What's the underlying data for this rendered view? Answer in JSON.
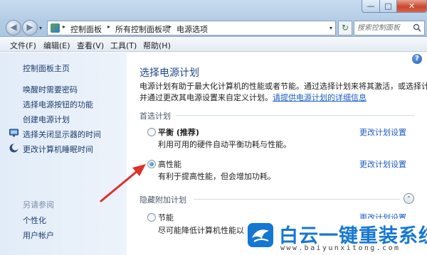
{
  "window": {
    "minimize_label": "—",
    "maximize_label": "□",
    "close_label": "✕"
  },
  "nav": {
    "back_label": "◀",
    "forward_label": "▶",
    "dropdown_label": "▾"
  },
  "address": {
    "crumbs": [
      "控制面板",
      "所有控制面板项",
      "电源选项"
    ],
    "separator": "▸",
    "dropdown_label": "▾",
    "refresh_label": "↻"
  },
  "search": {
    "placeholder": "搜索控制面板"
  },
  "menu": [
    "文件(F)",
    "编辑(E)",
    "查看(V)",
    "工具(T)",
    "帮助(H)"
  ],
  "sidebar": {
    "home": "控制面板主页",
    "items": [
      {
        "label": "唤醒时需要密码",
        "icon": ""
      },
      {
        "label": "选择电源按钮的功能",
        "icon": ""
      },
      {
        "label": "创建电源计划",
        "icon": ""
      },
      {
        "label": "选择关闭显示器的时间",
        "icon": "monitor-icon"
      },
      {
        "label": "更改计算机睡眠时间",
        "icon": "moon-icon"
      }
    ],
    "see_also_heading": "另请参阅",
    "see_also": [
      "个性化",
      "用户帐户"
    ]
  },
  "main": {
    "help_label": "?",
    "title": "选择电源计划",
    "description_line1": "电源计划有助于最大化计算机的性能或者节能。通过选择计划来将其激活，或选择计划",
    "description_line2": "并通过更改其电源设置来自定义计划。",
    "description_link": "请提供电源计划的详细信息",
    "preferred_heading": "首选计划",
    "hidden_heading": "隐藏附加计划",
    "collapse_label": "⌃",
    "plans": [
      {
        "name": "平衡 (推荐)",
        "desc": "利用可用的硬件自动平衡功耗与性能。",
        "link": "更改计划设置",
        "selected": false
      },
      {
        "name": "高性能",
        "desc": "有利于提高性能，但会增加功耗。",
        "link": "更改计划设置",
        "selected": true
      },
      {
        "name": "节能",
        "desc": "尽可能降低计算机性能以节能。",
        "link": "更改计划设置",
        "selected": false
      }
    ]
  },
  "colors": {
    "accent_title": "#1f4a8a",
    "link": "#1a5dc4",
    "arrow": "#e0302a",
    "watermark": "#1677d2"
  },
  "watermark": {
    "title": "白云一键重装系统",
    "url": "www.baiyunxitong.com"
  }
}
